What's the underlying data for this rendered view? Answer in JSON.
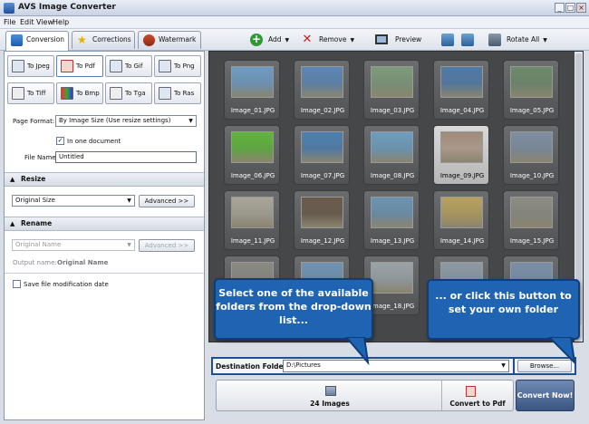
{
  "window": {
    "title": "AVS Image Converter",
    "controls": [
      "_",
      "□",
      "×"
    ]
  },
  "menu": [
    "File",
    "Edit",
    "View",
    "Help"
  ],
  "tabs": [
    {
      "label": "Conversion",
      "icon": "conversion-icon",
      "active": true
    },
    {
      "label": "Corrections",
      "icon": "star-icon",
      "active": false
    },
    {
      "label": "Watermark",
      "icon": "watermark-icon",
      "active": false
    }
  ],
  "toolbar": {
    "add": "Add",
    "remove": "Remove",
    "preview": "Preview",
    "rotate_all": "Rotate All"
  },
  "formats": [
    "To Jpeg",
    "To Pdf",
    "To Gif",
    "To Png",
    "To Tiff",
    "To Bmp",
    "To Tga",
    "To Ras"
  ],
  "selected_format": "To Pdf",
  "settings": {
    "page_format_label": "Page Format:",
    "page_format_value": "By Image Size (Use resize settings)",
    "one_document_label": "In one document",
    "one_document_checked": "✓",
    "file_name_label": "File Name:",
    "file_name_value": "Untitled"
  },
  "resize": {
    "header": "Resize",
    "value": "Original Size",
    "advanced": "Advanced >>"
  },
  "rename": {
    "header": "Rename",
    "value": "Original Name",
    "advanced": "Advanced >>",
    "output_name_label": "Output name:",
    "output_name_value": "Original Name"
  },
  "save_date_label": "Save file modification date",
  "images": [
    {
      "caption": "Image_01.JPG",
      "color": "#6f9bc1"
    },
    {
      "caption": "Image_02.JPG",
      "color": "#5b86b4"
    },
    {
      "caption": "Image_03.JPG",
      "color": "#7d9a7a"
    },
    {
      "caption": "Image_04.JPG",
      "color": "#4f7aa8"
    },
    {
      "caption": "Image_05.JPG",
      "color": "#6d8a6a"
    },
    {
      "caption": "Image_06.JPG",
      "color": "#5fb43a"
    },
    {
      "caption": "Image_07.JPG",
      "color": "#4d7fb0"
    },
    {
      "caption": "Image_08.JPG",
      "color": "#6e9dbd"
    },
    {
      "caption": "Image_09.JPG",
      "color": "#a08a78"
    },
    {
      "caption": "Image_10.JPG",
      "color": "#7e8fa1"
    },
    {
      "caption": "Image_11.JPG",
      "color": "#a9a597"
    },
    {
      "caption": "Image_12.JPG",
      "color": "#6a5a4a"
    },
    {
      "caption": "Image_13.JPG",
      "color": "#6c93b1"
    },
    {
      "caption": "Image_14.JPG",
      "color": "#b7a15d"
    },
    {
      "caption": "Image_15.JPG",
      "color": "#8c8c82"
    },
    {
      "caption": "",
      "color": "#8a8a82"
    },
    {
      "caption": "",
      "color": "#6f93b5"
    },
    {
      "caption": "Image_18.JPG",
      "color": "#9aa3a6"
    },
    {
      "caption": "",
      "color": "#8c9aa4"
    },
    {
      "caption": "",
      "color": "#7a90a8"
    }
  ],
  "selected_image": "Image_09.JPG",
  "destination": {
    "label": "Destination Folder:",
    "value": "D:\\Pictures",
    "browse": "Browse..."
  },
  "bottom": {
    "count": "24 Images",
    "convert_to": "Convert to Pdf",
    "convert_now": "Convert Now!"
  },
  "callouts": {
    "left": "Select one of the available folders from the drop-down list...",
    "right": "... or click this button to set your own folder"
  }
}
